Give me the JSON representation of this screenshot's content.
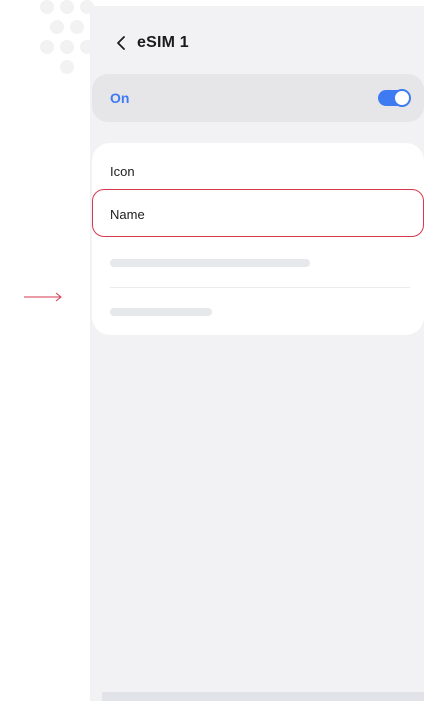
{
  "header": {
    "title": "eSIM 1",
    "back_icon": "chevron-left-icon"
  },
  "toggle_row": {
    "label": "On",
    "state": "on",
    "accent_color": "#3e7bf2"
  },
  "settings": {
    "items": [
      {
        "label": "Icon"
      },
      {
        "label": "Name",
        "highlighted": true,
        "highlight_color": "#d6394d"
      }
    ]
  },
  "annotation": {
    "pointer_icon": "arrow-right-icon",
    "color": "#d6394d"
  }
}
